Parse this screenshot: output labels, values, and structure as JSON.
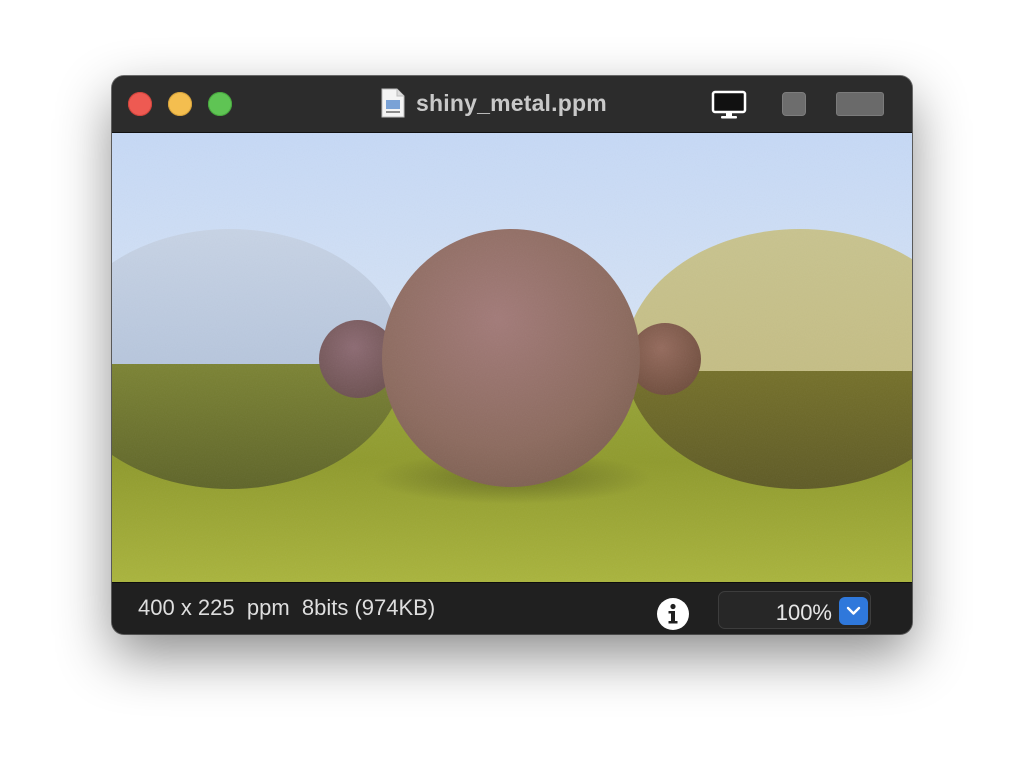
{
  "window": {
    "title": "shiny_metal.ppm",
    "file_icon": "document-icon"
  },
  "toolbar": {
    "icons": [
      "display-icon",
      "fullscreen-square-icon",
      "sidebar-toggle-icon"
    ]
  },
  "status": {
    "info": "400 x 225  ppm  8bits (974KB)",
    "info_icon": "info-circle-icon"
  },
  "zoom": {
    "value": "100%",
    "stepper_icon": "chevron-down-icon"
  },
  "colors": {
    "accent": "#2f78db",
    "close": "#ee5a52",
    "minimize": "#f4be4f",
    "zoom": "#5fc454"
  }
}
